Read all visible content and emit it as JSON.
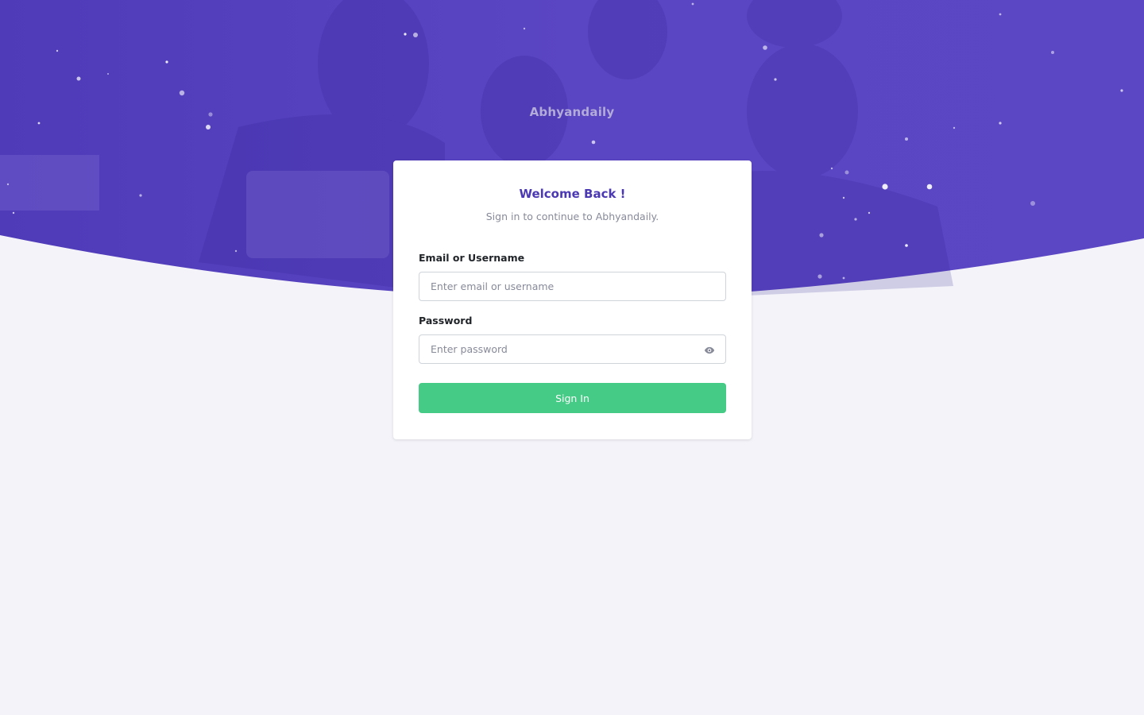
{
  "app": {
    "brand": "Abhyandaily"
  },
  "card": {
    "title": "Welcome Back !",
    "subtitle": "Sign in to continue to Abhyandaily."
  },
  "form": {
    "email_label": "Email or Username",
    "email_placeholder": "Enter email or username",
    "email_value": "",
    "password_label": "Password",
    "password_placeholder": "Enter password",
    "password_value": "",
    "submit_label": "Sign In"
  },
  "icons": {
    "password_toggle": "eye-icon"
  },
  "colors": {
    "hero_overlay": "#4b38b3",
    "title": "#4b38b3",
    "primary_button": "#45cb85",
    "page_background": "#f3f3f9"
  }
}
